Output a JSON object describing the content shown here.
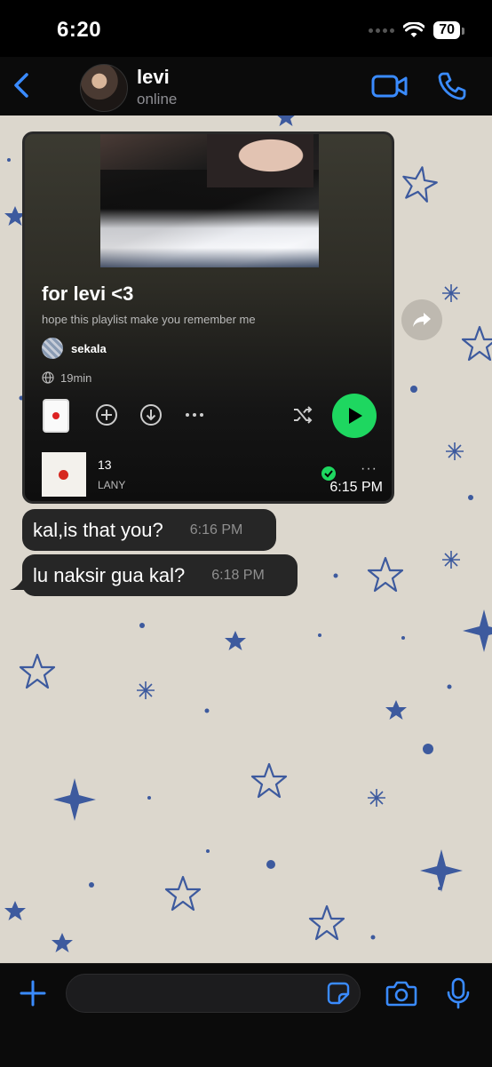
{
  "status_bar": {
    "time": "6:20",
    "battery": "70"
  },
  "header": {
    "contact_name": "levi",
    "contact_status": "online"
  },
  "playlist_card": {
    "title": "for levi <3",
    "description": "hope this playlist make you remember me",
    "owner": "sekala",
    "duration": "19min",
    "track": {
      "title": "13",
      "artist": "LANY"
    },
    "timestamp": "6:15 PM"
  },
  "messages": [
    {
      "text": "kal,is that you?",
      "time": "6:16 PM"
    },
    {
      "text": "lu naksir gua kal?",
      "time": "6:18 PM"
    }
  ],
  "input": {
    "value": ""
  },
  "colors": {
    "accent": "#3a8bff",
    "bubble": "#262626",
    "spotify_green": "#1ed760",
    "wallpaper": "#dcd7cd",
    "star": "#3d5a9e"
  }
}
